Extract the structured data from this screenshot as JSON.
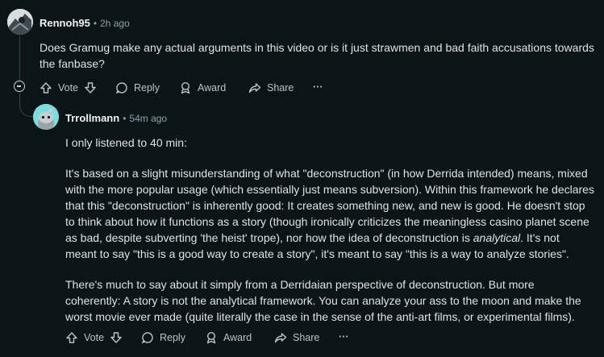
{
  "comment1": {
    "username": "Rennoh95",
    "timestamp": "2h ago",
    "body": [
      "Does Gramug make any actual arguments in this video or is it just strawmen and bad faith accusations towards",
      "the fanbase?"
    ],
    "actions": {
      "vote": "Vote",
      "reply": "Reply",
      "award": "Award",
      "share": "Share",
      "more": "···"
    }
  },
  "comment2": {
    "username": "Trrollmann",
    "timestamp": "54m ago",
    "paragraphs": [
      [
        "I only listened to 40 min:"
      ],
      [
        "It's based on a slight misunderstanding of what \"deconstruction\" (in how Derrida intended) means, mixed",
        "with the more popular usage (which essentially just means subversion). Within this framework he declares",
        "that this \"deconstruction\" is inherently good: It creates something new, and new is good. He doesn't stop",
        "to think about how it functions as a story (though ironically criticizes the meaningless casino planet scene",
        "as bad, despite subverting 'the heist' trope), nor how the idea of deconstruction is ",
        "meant to say \"this is a good way to create a story\", it's meant to say \"this is a way to analyze stories\"."
      ],
      [
        "There's much to say about it simply from a Derridaian perspective of deconstruction. But more",
        "coherently: A story is not the analytical framework. You can analyze your ass to the moon and make the",
        "worst movie ever made (quite literally the case in the sense of the anti-art films, or experimental films)."
      ]
    ],
    "italic_word": "analytical",
    "after_italic": ". It's not",
    "actions": {
      "vote": "Vote",
      "reply": "Reply",
      "award": "Award",
      "share": "Share",
      "more": "···"
    }
  }
}
